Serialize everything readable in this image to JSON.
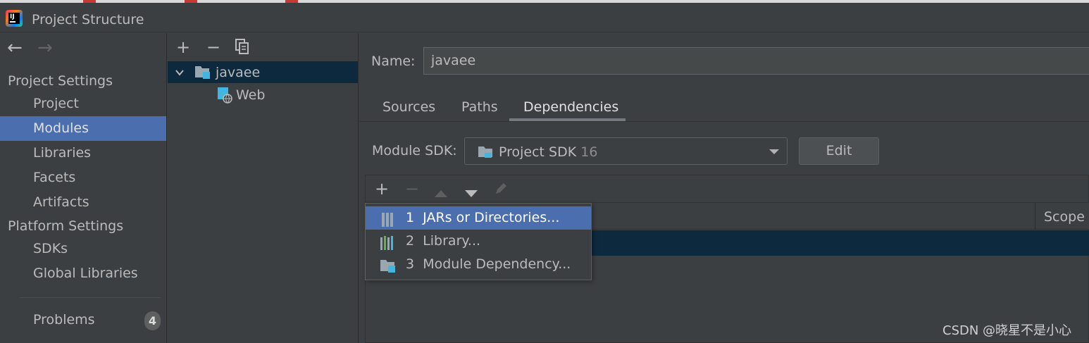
{
  "window": {
    "title": "Project Structure"
  },
  "nav": {
    "back_icon": "arrow-left-icon",
    "forward_icon": "arrow-right-icon",
    "project_settings_heading": "Project Settings",
    "project_items": [
      {
        "label": "Project"
      },
      {
        "label": "Modules",
        "selected": true
      },
      {
        "label": "Libraries"
      },
      {
        "label": "Facets"
      },
      {
        "label": "Artifacts"
      }
    ],
    "platform_settings_heading": "Platform Settings",
    "platform_items": [
      {
        "label": "SDKs"
      },
      {
        "label": "Global Libraries"
      }
    ],
    "problems": {
      "label": "Problems",
      "count": "4"
    }
  },
  "tree": {
    "toolbar": {
      "add": "+",
      "remove": "−",
      "copy_icon": "copy-icon"
    },
    "items": [
      {
        "label": "javaee",
        "icon": "module-folder-icon",
        "expanded": true,
        "selected": true
      },
      {
        "label": "Web",
        "icon": "web-facet-icon"
      }
    ]
  },
  "module": {
    "name_label": "Name:",
    "name_value": "javaee",
    "tabs": [
      {
        "label": "Sources"
      },
      {
        "label": "Paths"
      },
      {
        "label": "Dependencies",
        "active": true
      }
    ],
    "sdk_label": "Module SDK:",
    "sdk_value": "Project SDK",
    "sdk_version": "16",
    "edit_label": "Edit"
  },
  "dependencies": {
    "toolbar": {
      "add": "+",
      "remove": "−",
      "up_icon": "move-up-icon",
      "down_icon": "move-down-icon",
      "edit_icon": "pencil-icon"
    },
    "scope_header": "Scope"
  },
  "popup_menu": {
    "items": [
      {
        "number": "1",
        "label": "JARs or Directories...",
        "icon": "jar-icon",
        "active": true
      },
      {
        "number": "2",
        "label": "Library...",
        "icon": "library-icon"
      },
      {
        "number": "3",
        "label": "Module Dependency...",
        "icon": "module-icon"
      }
    ]
  },
  "watermark": "CSDN @晓星不是小心",
  "colors": {
    "background": "#3c3f41",
    "selection": "#4b6eaf",
    "row_selection": "#0d293e",
    "text": "#bbbbbb"
  }
}
